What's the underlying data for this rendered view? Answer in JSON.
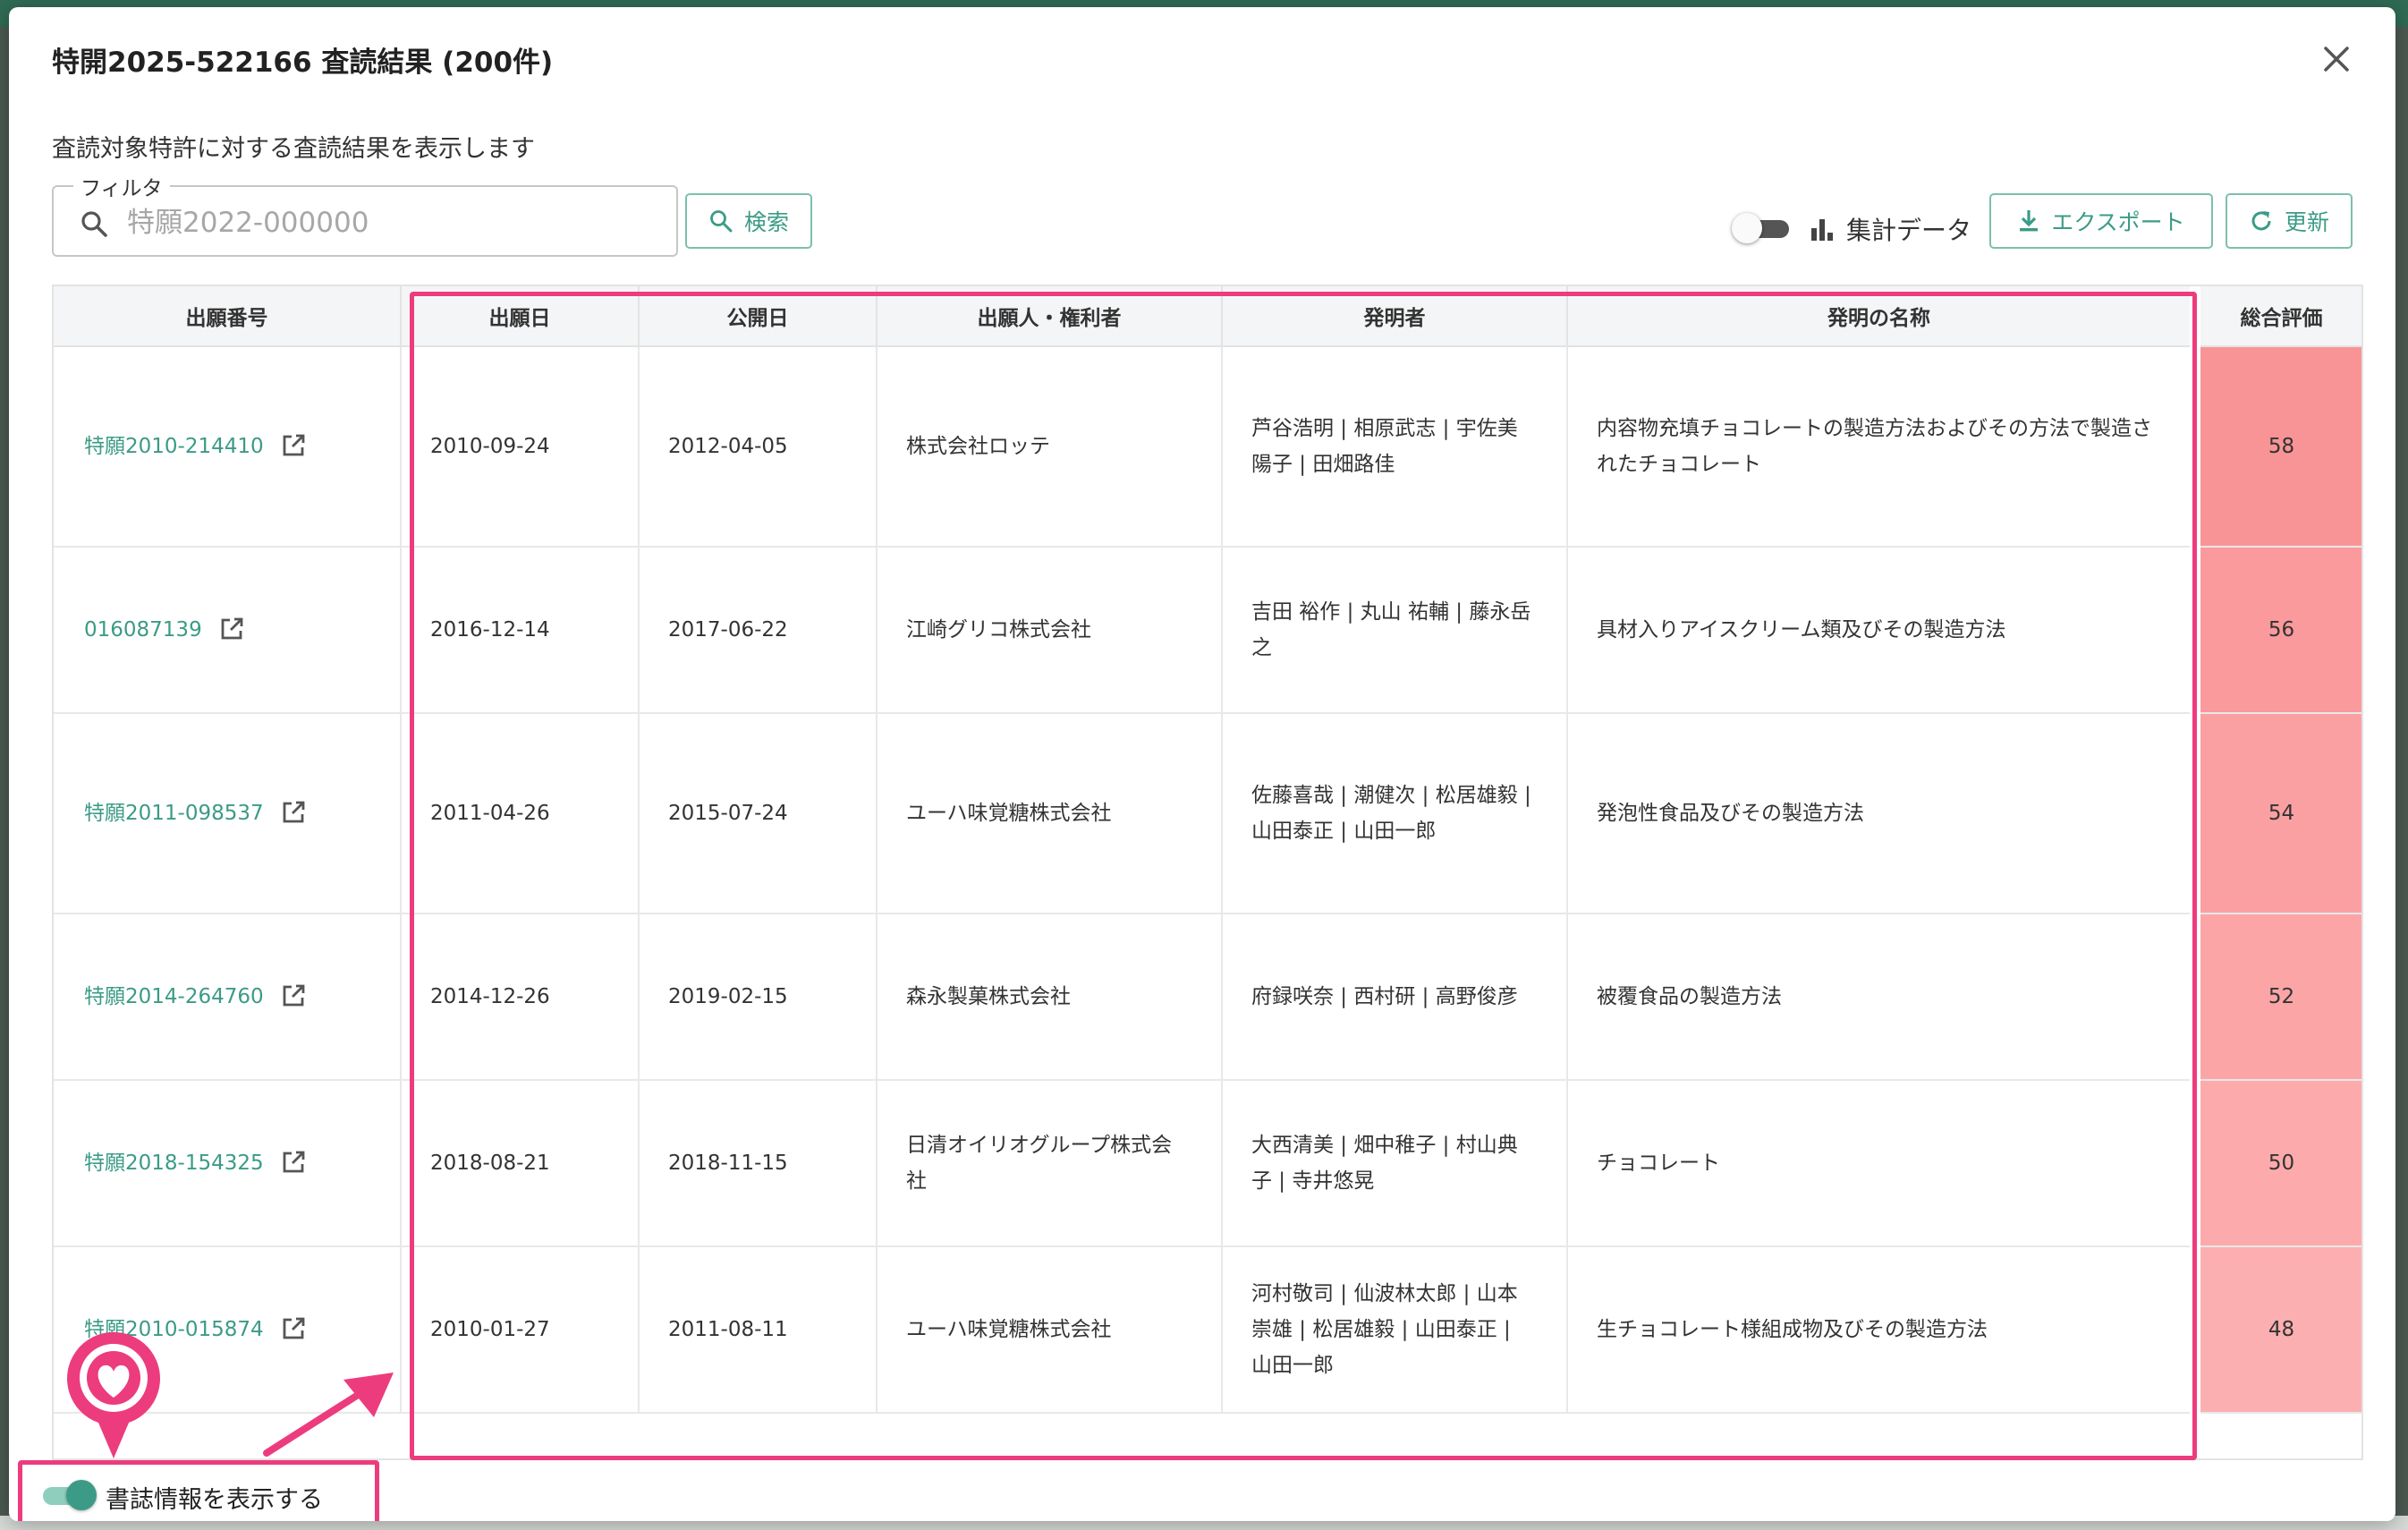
{
  "dialog": {
    "title": "特開2025-522166 査読結果 (200件)",
    "subtitle": "査読対象特許に対する査読結果を表示します"
  },
  "filter": {
    "legend": "フィルタ",
    "placeholder": "特願2022-000000",
    "value": ""
  },
  "toolbar": {
    "search_label": "検索",
    "stats_label": "集計データ",
    "export_label": "エクスポート",
    "refresh_label": "更新"
  },
  "table": {
    "headers": [
      "出願番号",
      "出願日",
      "公開日",
      "出願人・権利者",
      "発明者",
      "発明の名称",
      "総合評価"
    ],
    "rows": [
      {
        "app_no": "特願2010-214410",
        "filed": "2010-09-24",
        "published": "2012-04-05",
        "applicant": "株式会社ロッテ",
        "inventors": "芦谷浩明 | 相原武志 | 宇佐美陽子 | 田畑路佳",
        "title": "内容物充填チョコレートの製造方法およびその方法で製造されたチョコレート",
        "score": "58",
        "score_color": "#f99496"
      },
      {
        "app_no": "016087139",
        "filed": "2016-12-14",
        "published": "2017-06-22",
        "applicant": "江崎グリコ株式会社",
        "inventors": "吉田 裕作 | 丸山 祐輔 | 藤永岳之",
        "title": "具材入りアイスクリーム類及びその製造方法",
        "score": "56",
        "score_color": "#fa9a9c"
      },
      {
        "app_no": "特願2011-098537",
        "filed": "2011-04-26",
        "published": "2015-07-24",
        "applicant": "ユーハ味覚糖株式会社",
        "inventors": "佐藤喜哉 | 潮健次 | 松居雄毅 | 山田泰正 | 山田一郎",
        "title": "発泡性食品及びその製造方法",
        "score": "54",
        "score_color": "#fba0a2"
      },
      {
        "app_no": "特願2014-264760",
        "filed": "2014-12-26",
        "published": "2019-02-15",
        "applicant": "森永製菓株式会社",
        "inventors": "府録咲奈 | 西村研 | 高野俊彦",
        "title": "被覆食品の製造方法",
        "score": "52",
        "score_color": "#fba5a7"
      },
      {
        "app_no": "特願2018-154325",
        "filed": "2018-08-21",
        "published": "2018-11-15",
        "applicant": "日清オイリオグループ株式会社",
        "inventors": "大西清美 | 畑中稚子 | 村山典子 | 寺井悠晃",
        "title": "チョコレート",
        "score": "50",
        "score_color": "#fcaaac"
      },
      {
        "app_no": "特願2010-015874",
        "filed": "2010-01-27",
        "published": "2011-08-11",
        "applicant": "ユーハ味覚糖株式会社",
        "inventors": "河村敬司 | 仙波林太郎 | 山本崇雄 | 松居雄毅 | 山田泰正 | 山田一郎",
        "title": "生チョコレート様組成物及びその製造方法",
        "score": "48",
        "score_color": "#fcafb1"
      }
    ]
  },
  "footer": {
    "bibliography_toggle_label": "書誌情報を表示する"
  },
  "colors": {
    "accent": "#3b9b86",
    "highlight": "#ec3c7e"
  }
}
